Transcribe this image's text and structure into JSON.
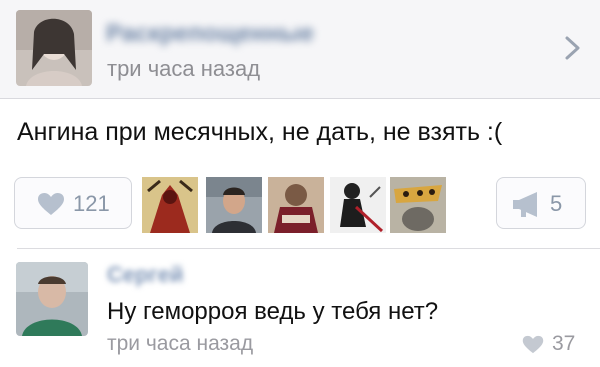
{
  "post": {
    "author_name": "Раскрепощенные",
    "time": "три часа назад",
    "text": "Ангина при месячных, не дать, не взять :(",
    "likes_count": "121",
    "reposts_count": "5"
  },
  "comment": {
    "author_name": "Сергей",
    "text": "Ну геморроя ведь у тебя нет?",
    "time": "три часа назад",
    "likes_count": "37"
  },
  "icons": {
    "chevron": "chevron-right-icon",
    "heart": "heart-icon",
    "repost": "megaphone-icon"
  },
  "colors": {
    "header_bg": "#f6f6f8",
    "link_blue": "#6f86a7",
    "muted_gray": "#8e8e93",
    "button_border": "#d4d6dc"
  }
}
